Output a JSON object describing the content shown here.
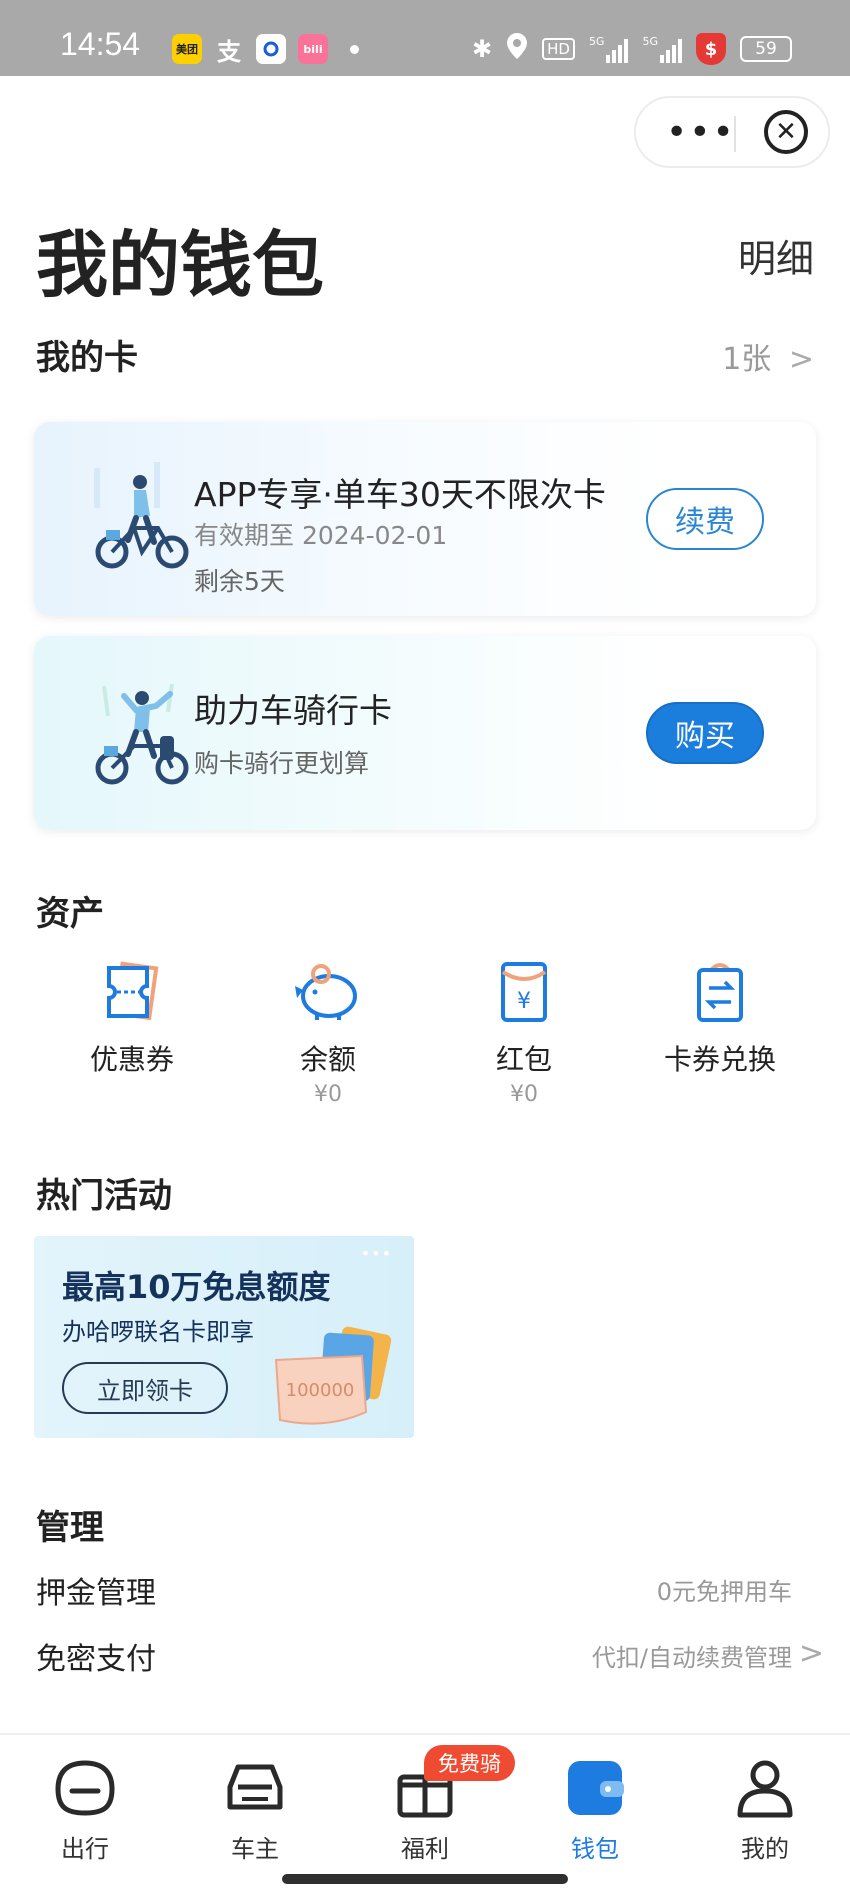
{
  "status_bar": {
    "time": "14:54",
    "apps": [
      {
        "icon": "meituan-icon",
        "text": "美团",
        "color": "#ffd000"
      },
      {
        "icon": "alipay-icon",
        "text": "支",
        "color": "#a9a9a9"
      },
      {
        "icon": "app-circle-icon",
        "text": "",
        "color": "#ffffff"
      },
      {
        "icon": "bilibili-icon",
        "text": "bili",
        "color": "#fb7299"
      }
    ],
    "battery": "59",
    "signal_label": "5G"
  },
  "capsule": {
    "more": "•••",
    "close": "✕"
  },
  "header": {
    "title": "我的钱包",
    "detail": "明细"
  },
  "my_cards": {
    "title": "我的卡",
    "count": "1张",
    "items": [
      {
        "title": "APP专享·单车30天不限次卡",
        "sub1": "有效期至 2024-02-01",
        "sub2": "剩余5天",
        "button": "续费"
      },
      {
        "title": "助力车骑行卡",
        "sub1": "购卡骑行更划算",
        "button": "购买"
      }
    ]
  },
  "assets": {
    "title": "资产",
    "items": [
      {
        "label": "优惠券",
        "value": "",
        "icon": "coupon-icon"
      },
      {
        "label": "余额",
        "value": "¥0",
        "icon": "piggy-bank-icon"
      },
      {
        "label": "红包",
        "value": "¥0",
        "icon": "red-packet-icon"
      },
      {
        "label": "卡券兑换",
        "value": "",
        "icon": "exchange-bag-icon"
      }
    ]
  },
  "hot": {
    "title": "热门活动",
    "promo": {
      "title": "最高10万免息额度",
      "sub": "办哈啰联名卡即享",
      "button": "立即领卡",
      "amount": "100000",
      "dots": "•••"
    }
  },
  "management": {
    "title": "管理",
    "rows": [
      {
        "label": "押金管理",
        "value": "0元免押用车"
      },
      {
        "label": "免密支付",
        "value": "代扣/自动续费管理"
      }
    ]
  },
  "tabbar": {
    "badge": "免费骑",
    "tabs": [
      {
        "label": "出行",
        "icon": "travel-icon"
      },
      {
        "label": "车主",
        "icon": "car-icon"
      },
      {
        "label": "福利",
        "icon": "gift-icon"
      },
      {
        "label": "钱包",
        "icon": "wallet-icon",
        "active": true
      },
      {
        "label": "我的",
        "icon": "profile-icon"
      }
    ]
  },
  "colors": {
    "accent": "#1e7be0",
    "badge": "#ef4b32",
    "status_bar": "#a9a9a9"
  }
}
